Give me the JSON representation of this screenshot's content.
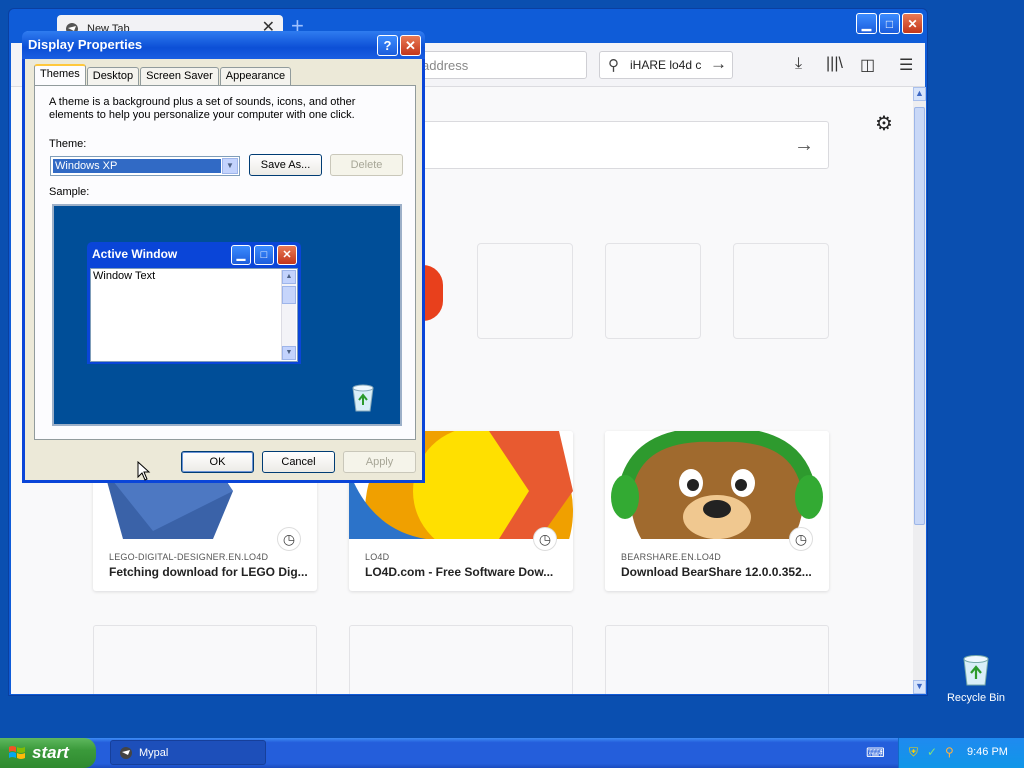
{
  "browser": {
    "tab_title": "New Tab",
    "tab_close": "✕",
    "new_tab": "+",
    "url_placeholder": "address",
    "search_text": "iHARE lo4d c",
    "controls": {
      "minimize": "▁",
      "maximize": "□",
      "close": "✕"
    }
  },
  "cards": [
    {
      "host": "LEGO-DIGITAL-DESIGNER.EN.LO4D",
      "title": "Fetching download for LEGO Dig..."
    },
    {
      "host": "LO4D",
      "title": "LO4D.com - Free Software Dow..."
    },
    {
      "host": "BEARSHARE.EN.LO4D",
      "title": "Download BearShare 12.0.0.352..."
    }
  ],
  "dialog": {
    "title": "Display Properties",
    "help": "?",
    "close": "✕",
    "tabs": [
      "Themes",
      "Desktop",
      "Screen Saver",
      "Appearance"
    ],
    "description": "A theme is a background plus a set of sounds, icons, and other elements to help you personalize your computer with one click.",
    "theme_label": "Theme:",
    "theme_value": "Windows XP",
    "save_as": "Save As...",
    "delete": "Delete",
    "sample_label": "Sample:",
    "sample_window_title": "Active Window",
    "sample_window_text": "Window Text",
    "ok": "OK",
    "cancel": "Cancel",
    "apply": "Apply"
  },
  "desktop": {
    "recycle_bin": "Recycle Bin"
  },
  "taskbar": {
    "start": "start",
    "task_label": "Mypal",
    "clock": "9:46 PM"
  }
}
